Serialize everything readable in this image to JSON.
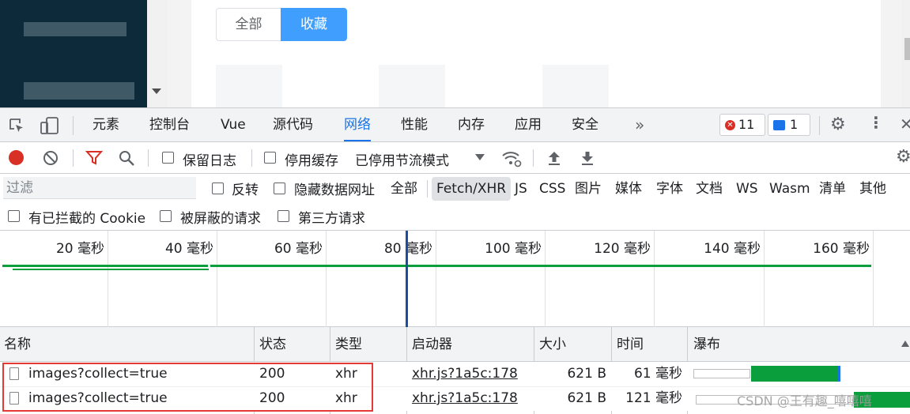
{
  "page": {
    "segments": [
      "全部",
      "收藏"
    ]
  },
  "tabs": [
    "元素",
    "控制台",
    "Vue",
    "源代码",
    "网络",
    "性能",
    "内存",
    "应用",
    "安全"
  ],
  "more_tabs_label": "»",
  "badges": {
    "errors": "11",
    "messages": "1"
  },
  "toolbar": {
    "preserve_log": "保留日志",
    "disable_cache": "停用缓存",
    "throttling": "已停用节流模式"
  },
  "filter": {
    "placeholder": "过滤",
    "invert": "反转",
    "hide_data_urls": "隐藏数据网址",
    "types": [
      "全部",
      "Fetch/XHR",
      "JS",
      "CSS",
      "图片",
      "媒体",
      "字体",
      "文档",
      "WS",
      "Wasm",
      "清单",
      "其他"
    ],
    "active_type": "Fetch/XHR"
  },
  "blocked": {
    "blocked_cookies": "有已拦截的 Cookie",
    "blocked_requests": "被屏蔽的请求",
    "third_party": "第三方请求"
  },
  "timeline_ticks": [
    "20 毫秒",
    "40 毫秒",
    "60 毫秒",
    "80 毫秒",
    "100 毫秒",
    "120 毫秒",
    "140 毫秒",
    "160 毫秒"
  ],
  "table": {
    "headers": [
      "名称",
      "状态",
      "类型",
      "启动器",
      "大小",
      "时间",
      "瀑布"
    ],
    "rows": [
      {
        "name": "images?collect=true",
        "status": "200",
        "type": "xhr",
        "initiator": "xhr.js?1a5c:178",
        "size": "621 B",
        "time": "61 毫秒"
      },
      {
        "name": "images?collect=true",
        "status": "200",
        "type": "xhr",
        "initiator": "xhr.js?1a5c:178",
        "size": "621 B",
        "time": "121 毫秒"
      }
    ]
  },
  "watermark": "CSDN @王有趣_嘻嘻嘻",
  "colors": {
    "accent": "#1a73e8",
    "segment_active": "#409eff",
    "highlight_box": "#e53935",
    "waterfall": "#0a9e3c"
  }
}
